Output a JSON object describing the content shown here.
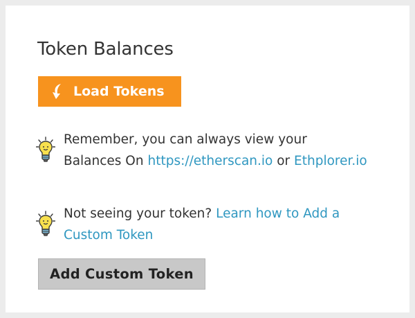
{
  "section": {
    "title": "Token Balances"
  },
  "load_tokens": {
    "label": "Load Tokens",
    "icon": "download-arrow-icon",
    "color": "#f7931e"
  },
  "tips": [
    {
      "icon": "lightbulb-icon",
      "text_before": "Remember, you can always view your Balances On ",
      "link1": "https://etherscan.io",
      "text_between": " or ",
      "link2": "Ethplorer.io"
    },
    {
      "icon": "lightbulb-icon",
      "text_before": "Not seeing your token? ",
      "link1": "Learn how to Add a Custom Token"
    }
  ],
  "add_custom_token": {
    "label": "Add Custom Token"
  },
  "colors": {
    "link": "#2f97c0",
    "accent": "#f7931e",
    "secondary_button": "#c8c8c8"
  }
}
